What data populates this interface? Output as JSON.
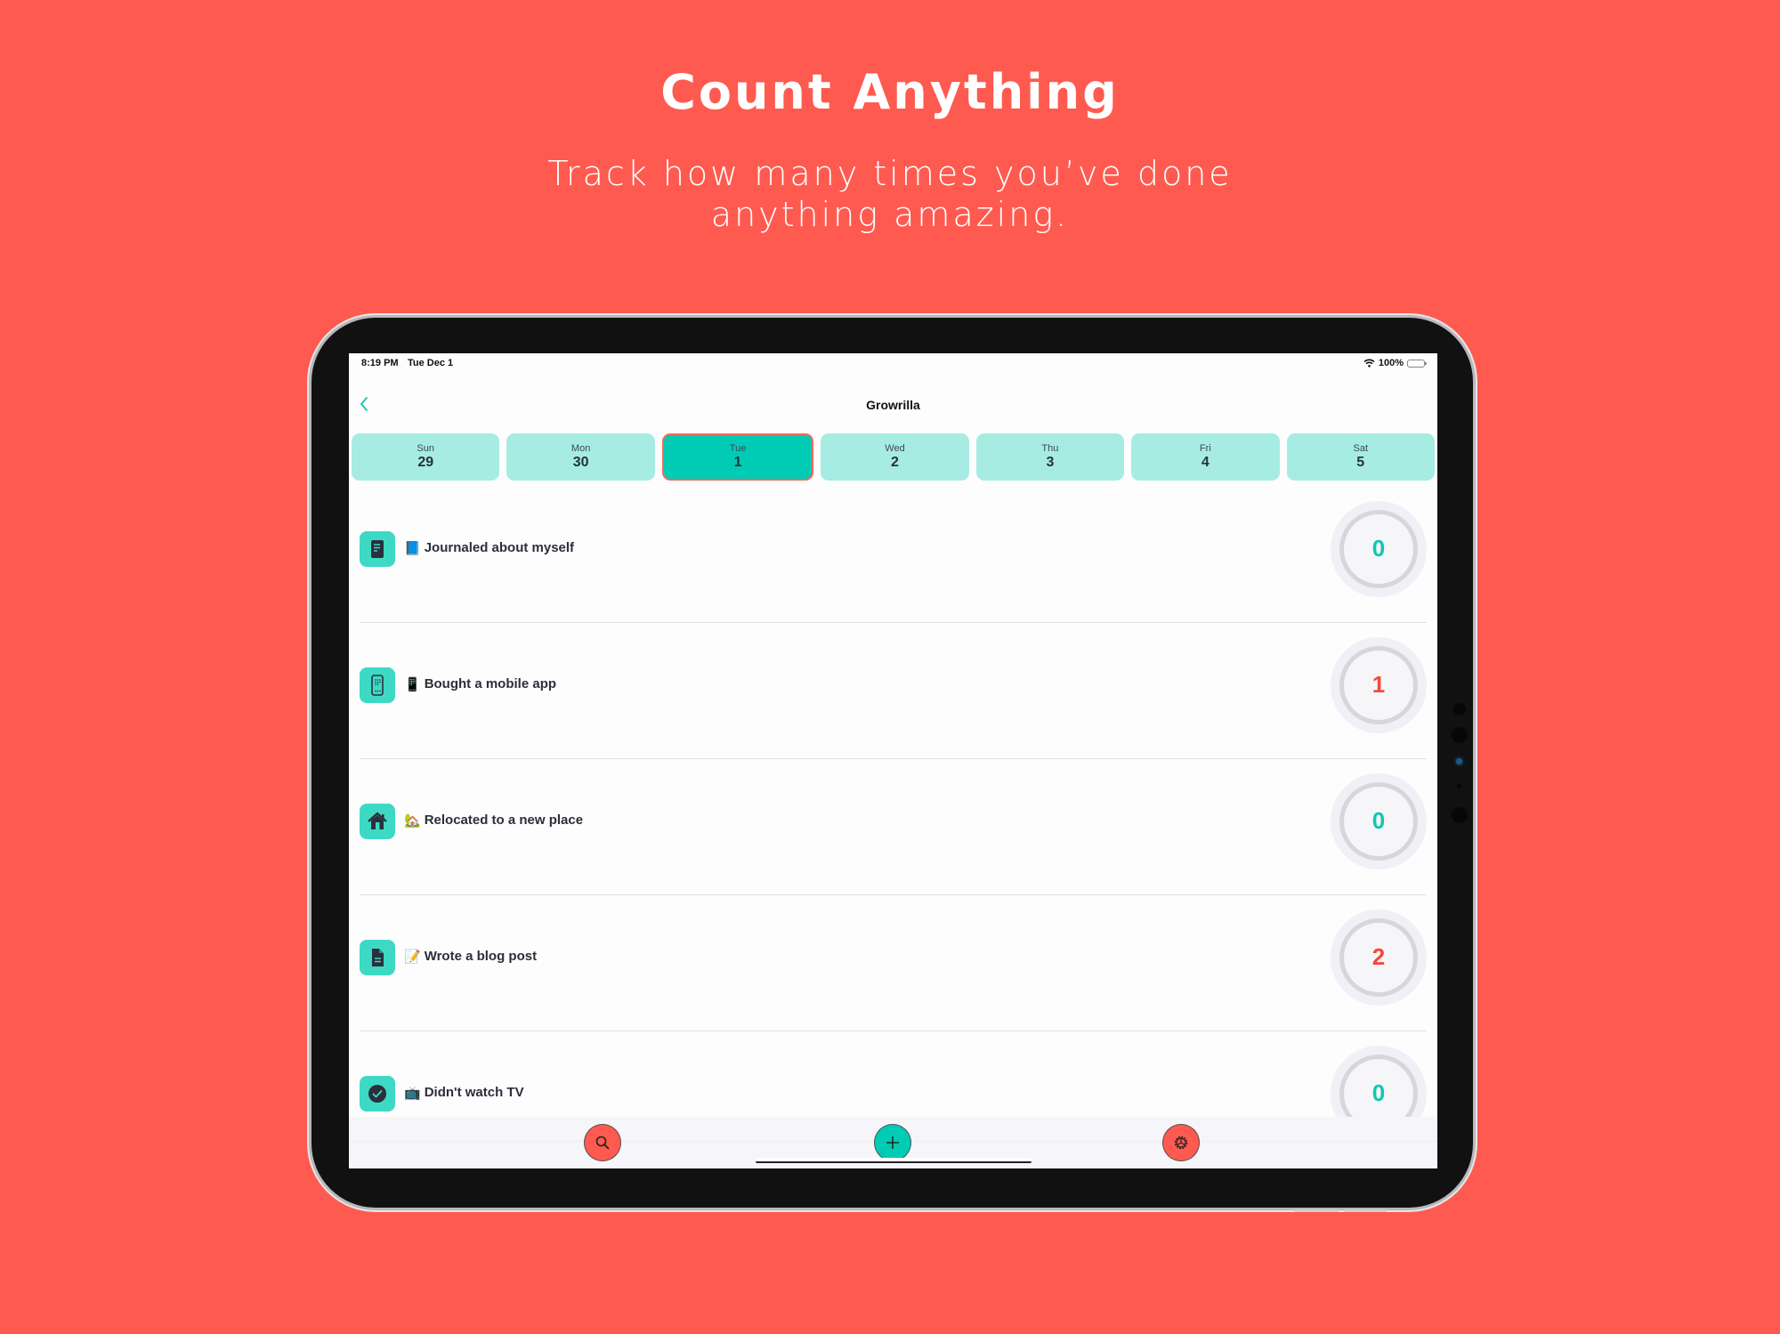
{
  "promo": {
    "headline": "Count Anything",
    "subline_1": "Track how many times you’ve done",
    "subline_2": "anything amazing."
  },
  "colors": {
    "background": "#FF5A4F",
    "accent": "#00CCB5",
    "day_tile": "#A6ECE3",
    "count_zero": "#10C7B0",
    "count_nonzero": "#F4473C",
    "danger": "#FF5A4F"
  },
  "status_bar": {
    "time": "8:19 PM",
    "date": "Tue Dec 1",
    "wifi_icon": "wifi-icon",
    "battery": "100%",
    "battery_icon": "battery-icon"
  },
  "nav": {
    "back_icon": "chevron-left-icon",
    "back_glyph": "‹",
    "title": "Growrilla"
  },
  "days": [
    {
      "name": "Sun",
      "num": "29",
      "selected": false
    },
    {
      "name": "Mon",
      "num": "30",
      "selected": false
    },
    {
      "name": "Tue",
      "num": "1",
      "selected": true
    },
    {
      "name": "Wed",
      "num": "2",
      "selected": false
    },
    {
      "name": "Thu",
      "num": "3",
      "selected": false
    },
    {
      "name": "Fri",
      "num": "4",
      "selected": false
    },
    {
      "name": "Sat",
      "num": "5",
      "selected": false
    }
  ],
  "habits": [
    {
      "icon": "journal-icon",
      "emoji": "📘",
      "label": "Journaled about myself",
      "count": "0"
    },
    {
      "icon": "mobile-phone-icon",
      "emoji": "📱",
      "label": "Bought a mobile app",
      "count": "1"
    },
    {
      "icon": "house-icon",
      "emoji": "🏡",
      "label": "Relocated to a new place",
      "count": "0"
    },
    {
      "icon": "document-icon",
      "emoji": "📝",
      "label": "Wrote a blog post",
      "count": "2"
    },
    {
      "icon": "check-circle-icon",
      "emoji": "📺",
      "label": "Didn't watch TV",
      "count": "0"
    }
  ],
  "toolbar": {
    "search_icon": "search-icon",
    "add_icon": "plus-icon",
    "add_glyph": "+",
    "settings_icon": "gear-icon"
  }
}
